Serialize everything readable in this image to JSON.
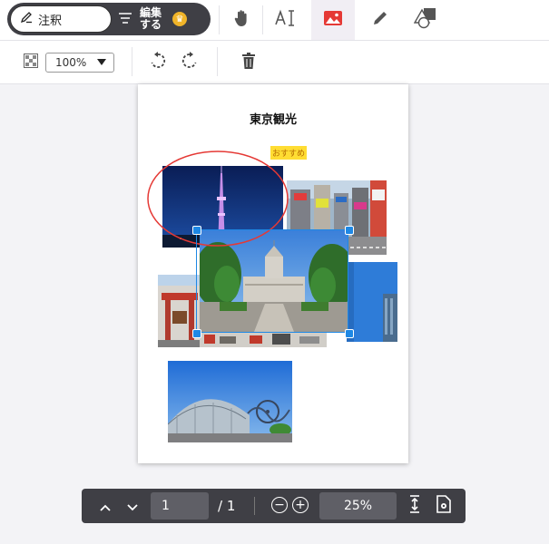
{
  "toolbar": {
    "annotate_label": "注釈",
    "edit_label": "編集する",
    "tools": [
      "hand-tool",
      "text-tool",
      "image-tool",
      "pen-tool",
      "shape-tool"
    ],
    "active_tool": "image-tool",
    "accent_color": "#e53935"
  },
  "subtoolbar": {
    "zoom_value": "100%"
  },
  "document": {
    "title": "東京観光",
    "tag": "おすすめ",
    "photos": [
      "tokyo-skytree-night",
      "shibuya-street",
      "national-diet-building",
      "blue-sky-tower",
      "red-gate-building",
      "tokyo-dome-city"
    ]
  },
  "bottombar": {
    "page_current": "1",
    "page_total": "/ 1",
    "zoom": "25%"
  },
  "colors": {
    "selection": "#1e88e5",
    "toolbar_dark": "#3f3f45",
    "tag_bg": "#ffdd33"
  }
}
